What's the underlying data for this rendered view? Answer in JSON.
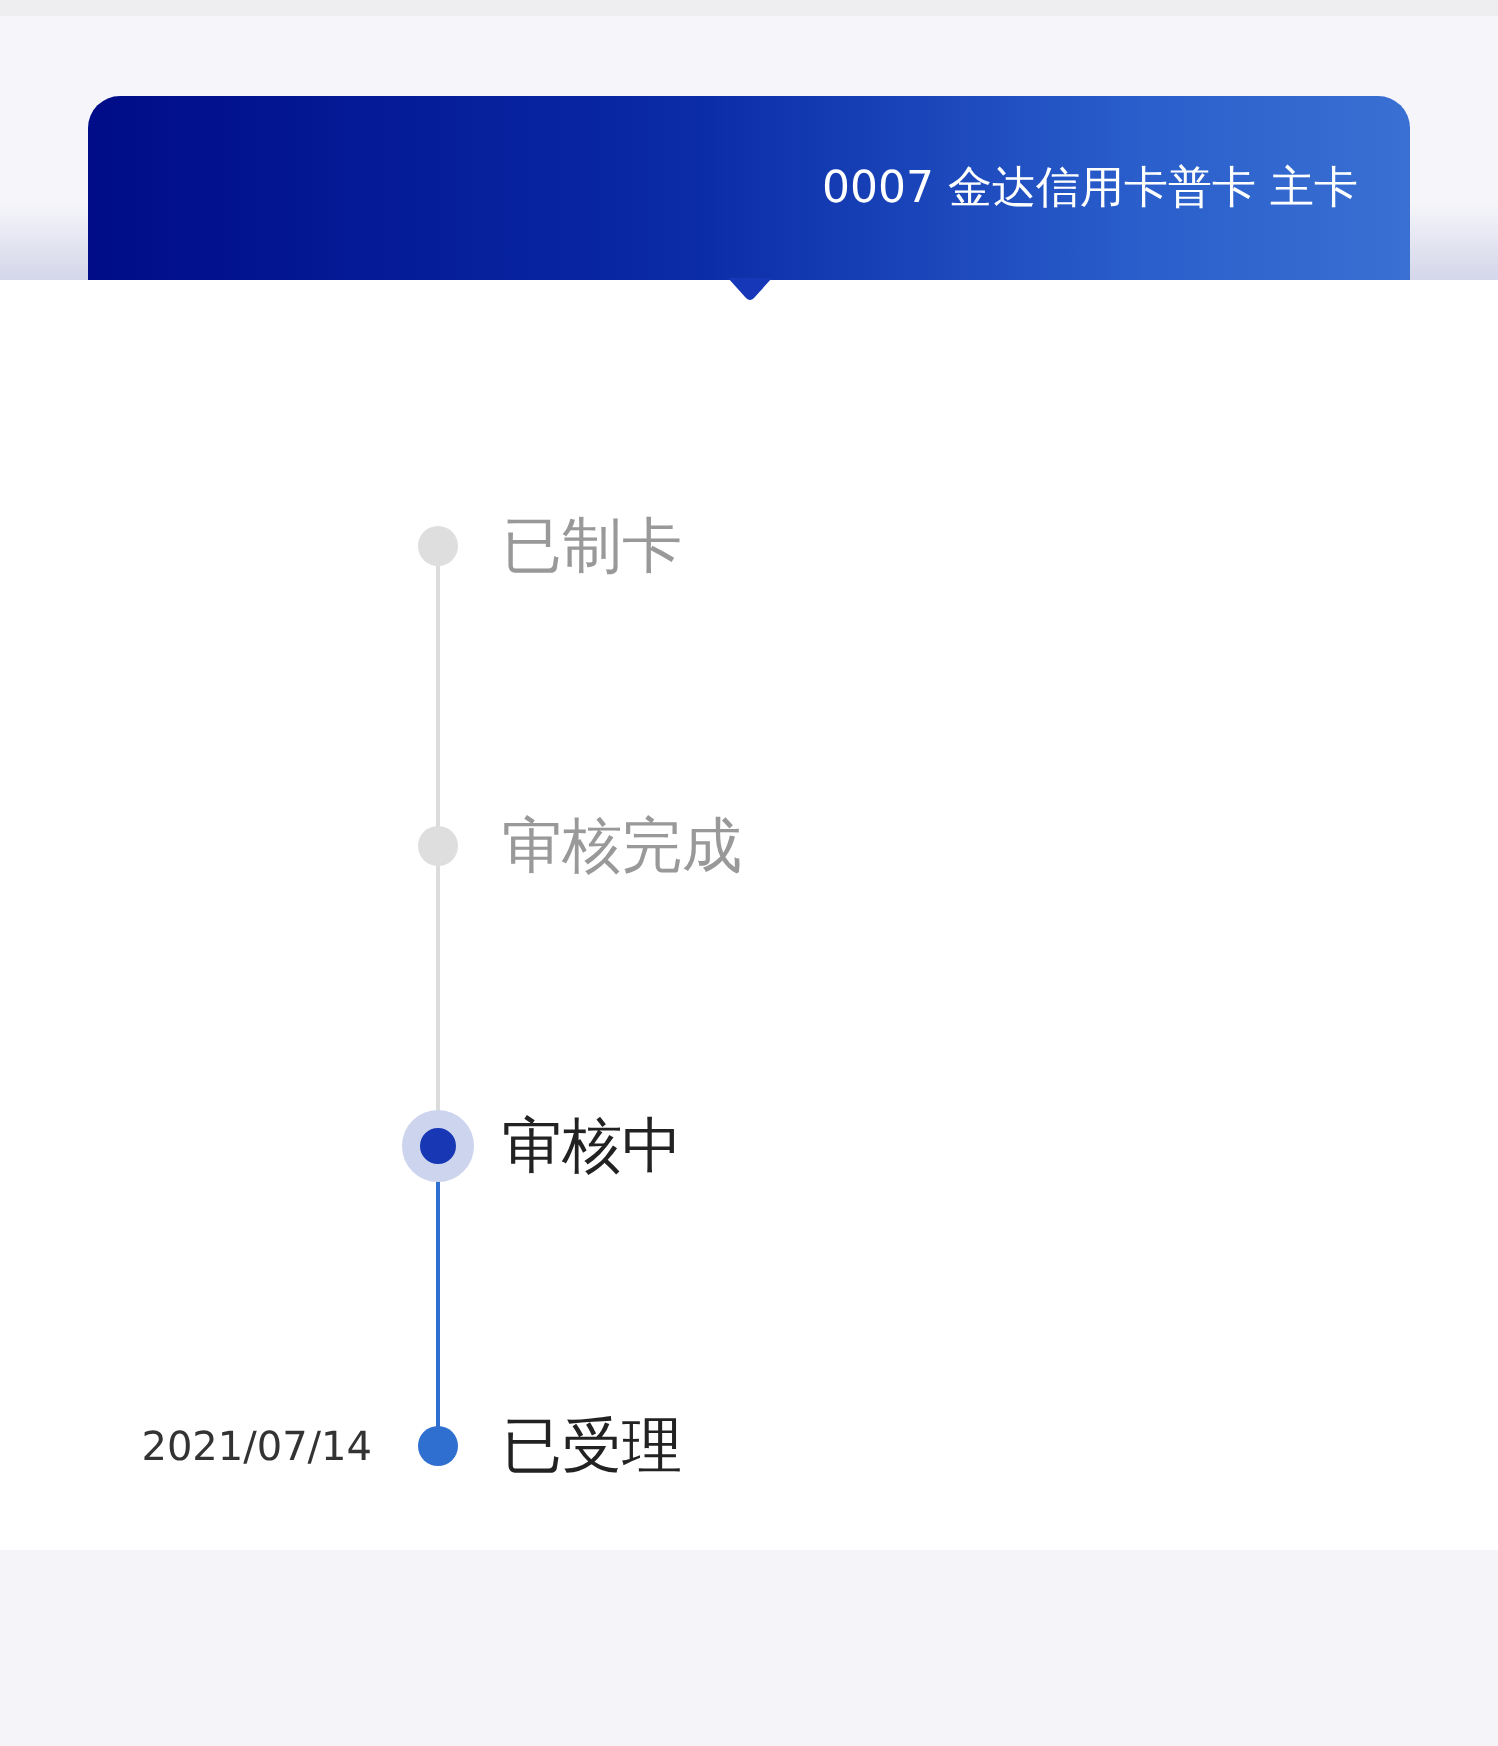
{
  "card": {
    "title": "0007 金达信用卡普卡 主卡"
  },
  "steps": [
    {
      "label": "已制卡",
      "reached": false,
      "current": false
    },
    {
      "label": "审核完成",
      "reached": false,
      "current": false
    },
    {
      "label": "审核中",
      "reached": true,
      "current": true
    },
    {
      "label": "已受理",
      "reached": true,
      "current": false,
      "date": "2021/07/14"
    }
  ]
}
